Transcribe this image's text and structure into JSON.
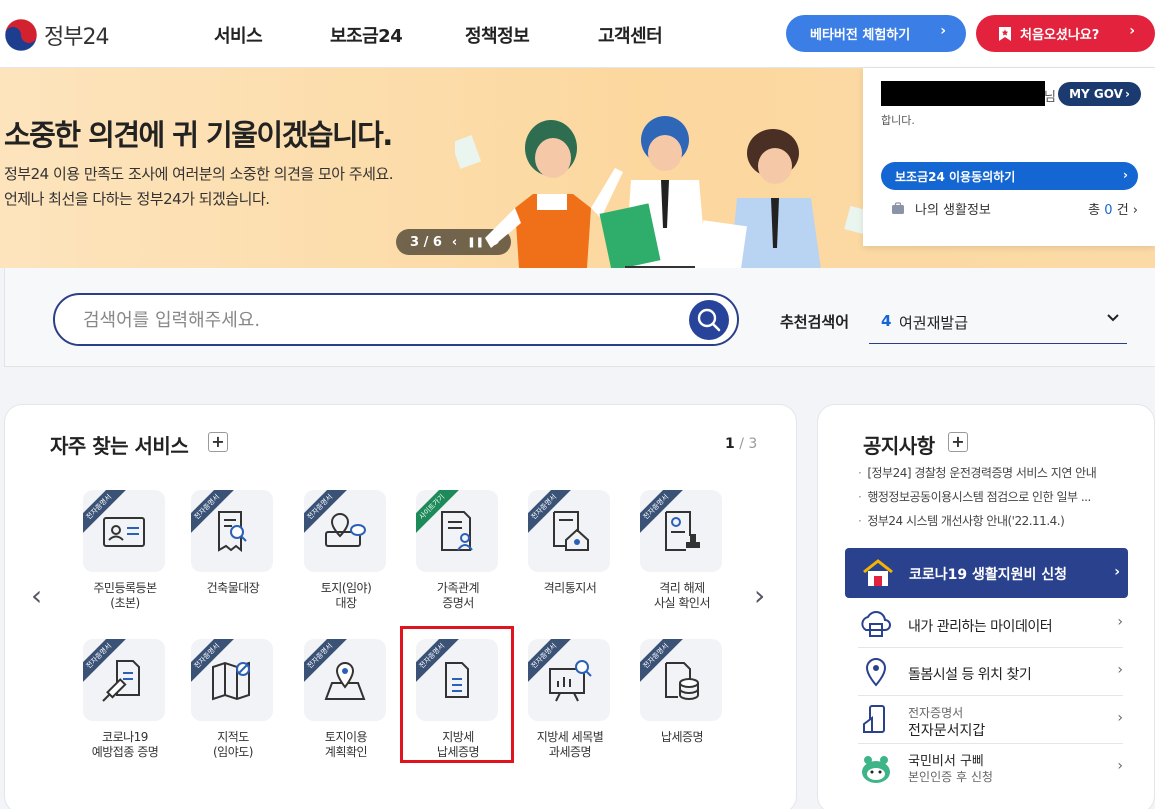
{
  "header": {
    "logo_text": "정부24",
    "nav": [
      "서비스",
      "보조금24",
      "정책정보",
      "고객센터"
    ],
    "beta_button": "베타버전 체험하기",
    "first_visit_button": "처음오셨나요?"
  },
  "banner": {
    "title": "소중한 의견에 귀 기울이겠습니다.",
    "description": "정부24 이용 만족도 조사에 여러분의 소중한 의견을 모아 주세요.\n언제나 최선을 다하는 정부24가 되겠습니다.",
    "slide_indicator": "3 / 6"
  },
  "mygov": {
    "suffix": "님",
    "button": "MY GOV",
    "greeting": "합니다.",
    "consent_button": "보조금24 이용동의하기",
    "life_info_label": "나의 생활정보",
    "count_prefix": "총",
    "count": "0",
    "count_suffix": "건"
  },
  "search": {
    "placeholder": "검색어를 입력해주세요.",
    "recommend_label": "추천검색어",
    "recommend_num": "4",
    "recommend_term": "여권재발급"
  },
  "frequent": {
    "title": "자주 찾는 서비스",
    "page_current": "1",
    "page_total": "/ 3",
    "services": [
      {
        "label": "주민등록등본\n(초본)",
        "ribbon": "전자증명서"
      },
      {
        "label": "건축물대장",
        "ribbon": "전자증명서"
      },
      {
        "label": "토지(임야)\n대장",
        "ribbon": "전자증명서"
      },
      {
        "label": "가족관계\n증명서",
        "ribbon": "사이트가기"
      },
      {
        "label": "격리통지서",
        "ribbon": "전자증명서"
      },
      {
        "label": "격리 해제\n사실 확인서",
        "ribbon": "전자증명서"
      },
      {
        "label": "코로나19\n예방접종 증명",
        "ribbon": "전자증명서"
      },
      {
        "label": "지적도\n(임야도)",
        "ribbon": "전자증명서"
      },
      {
        "label": "토지이용\n계획확인",
        "ribbon": "전자증명서"
      },
      {
        "label": "지방세\n납세증명",
        "ribbon": "전자증명서"
      },
      {
        "label": "지방세 세목별\n과세증명",
        "ribbon": "전자증명서"
      },
      {
        "label": "납세증명",
        "ribbon": "전자증명서"
      }
    ]
  },
  "notice": {
    "title": "공지사항",
    "items": [
      "[정부24] 경찰청 운전경력증명 서비스 지연 안내",
      "행정정보공동이용시스템 점검으로 인한 일부 ...",
      "정부24 시스템 개선사항 안내('22.11.4.)"
    ],
    "covid_button": "코로나19 생활지원비 신청",
    "quick": {
      "mydata": "내가 관리하는 마이데이터",
      "care": "돌봄시설 등 위치 찾기",
      "wallet_sub": "전자증명서",
      "wallet_main": "전자문서지갑",
      "bipper_sub": "국민비서 구삐",
      "bipper_main": "본인인증 후 신청"
    }
  },
  "colors": {
    "primary": "#2a418e",
    "accent_blue": "#3a7ee6",
    "accent_red": "#e3223d",
    "highlight": "#e0141e"
  }
}
